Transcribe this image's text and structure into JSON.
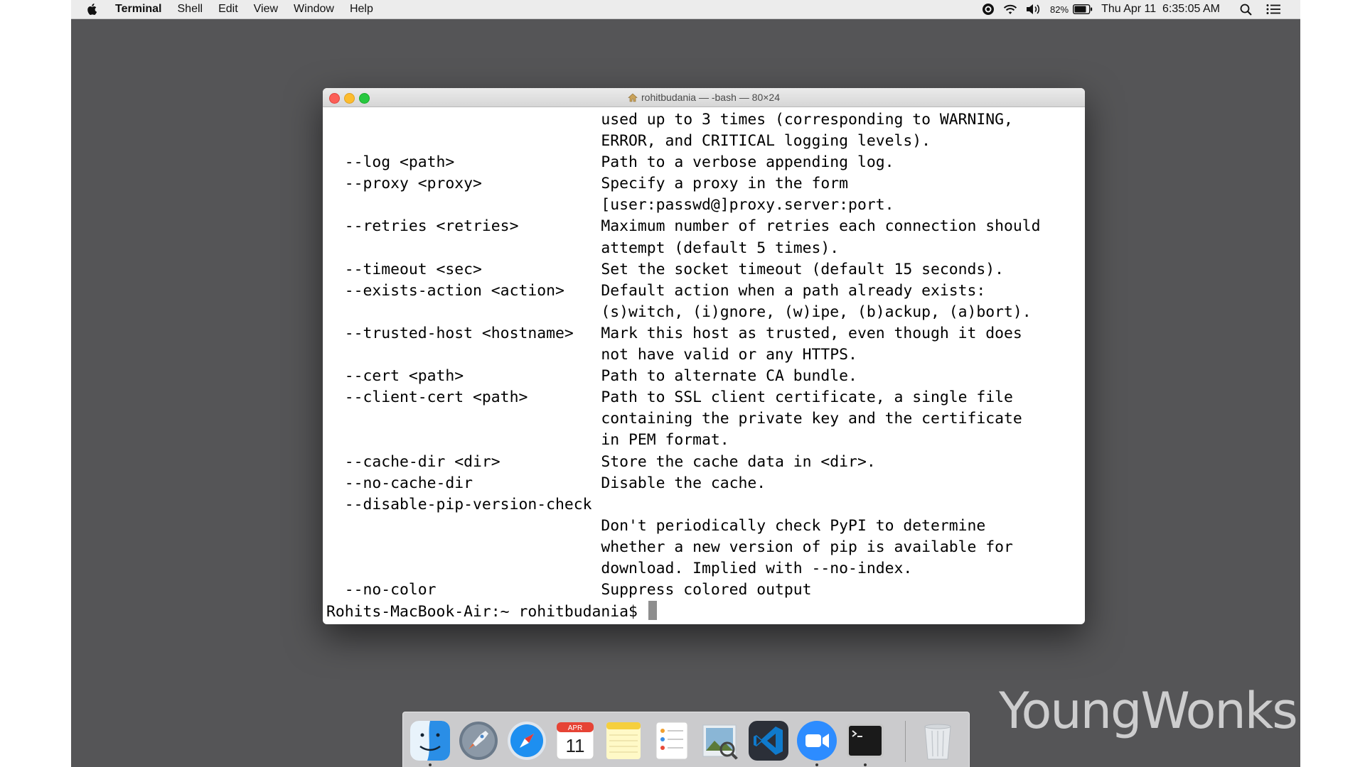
{
  "menubar": {
    "app_name": "Terminal",
    "items": [
      "Shell",
      "Edit",
      "View",
      "Window",
      "Help"
    ],
    "battery_percent": "82%",
    "datetime": "Thu Apr 11  6:35:05 AM"
  },
  "terminal": {
    "title": "rohitbudania — -bash — 80×24",
    "lines": [
      "                              used up to 3 times (corresponding to WARNING,",
      "                              ERROR, and CRITICAL logging levels).",
      "  --log <path>                Path to a verbose appending log.",
      "  --proxy <proxy>             Specify a proxy in the form",
      "                              [user:passwd@]proxy.server:port.",
      "  --retries <retries>         Maximum number of retries each connection should",
      "                              attempt (default 5 times).",
      "  --timeout <sec>             Set the socket timeout (default 15 seconds).",
      "  --exists-action <action>    Default action when a path already exists:",
      "                              (s)witch, (i)gnore, (w)ipe, (b)ackup, (a)bort).",
      "  --trusted-host <hostname>   Mark this host as trusted, even though it does",
      "                              not have valid or any HTTPS.",
      "  --cert <path>               Path to alternate CA bundle.",
      "  --client-cert <path>        Path to SSL client certificate, a single file",
      "                              containing the private key and the certificate",
      "                              in PEM format.",
      "  --cache-dir <dir>           Store the cache data in <dir>.",
      "  --no-cache-dir              Disable the cache.",
      "  --disable-pip-version-check",
      "                              Don't periodically check PyPI to determine",
      "                              whether a new version of pip is available for",
      "                              download. Implied with --no-index.",
      "  --no-color                  Suppress colored output"
    ],
    "prompt": "Rohits-MacBook-Air:~ rohitbudania$ "
  },
  "dock": {
    "calendar_month": "APR",
    "calendar_day": "11",
    "items": [
      "finder-icon",
      "launchpad-icon",
      "safari-icon",
      "calendar-icon",
      "notes-icon",
      "reminders-icon",
      "preview-icon",
      "vscode-icon",
      "zoom-icon",
      "terminal-icon",
      "trash-icon"
    ]
  },
  "watermark": "YoungWonks"
}
